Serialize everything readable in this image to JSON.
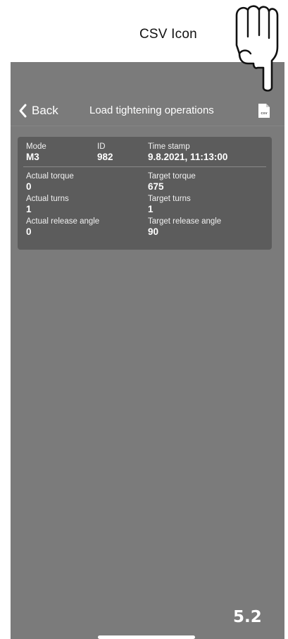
{
  "annotation": {
    "label": "CSV Icon"
  },
  "nav": {
    "back_label": "Back",
    "title": "Load tightening operations",
    "csv_icon_text": "csv"
  },
  "record": {
    "mode_label": "Mode",
    "mode_value": "M3",
    "id_label": "ID",
    "id_value": "982",
    "timestamp_label": "Time stamp",
    "timestamp_value": "9.8.2021, 11:13:00",
    "actual_torque_label": "Actual torque",
    "actual_torque_value": "0",
    "target_torque_label": "Target torque",
    "target_torque_value": "675",
    "actual_turns_label": "Actual turns",
    "actual_turns_value": "1",
    "target_turns_label": "Target turns",
    "target_turns_value": "1",
    "actual_release_angle_label": "Actual release angle",
    "actual_release_angle_value": "0",
    "target_release_angle_label": "Target release angle",
    "target_release_angle_value": "90"
  },
  "footer": {
    "figure_number": "5.2"
  },
  "colors": {
    "screen_bg": "#7b7b7b",
    "card_bg": "#5c5c5c",
    "text": "#ffffff"
  },
  "icons": {
    "back": "chevron-left-icon",
    "csv": "csv-file-icon",
    "pointer": "pointing-hand-icon"
  }
}
